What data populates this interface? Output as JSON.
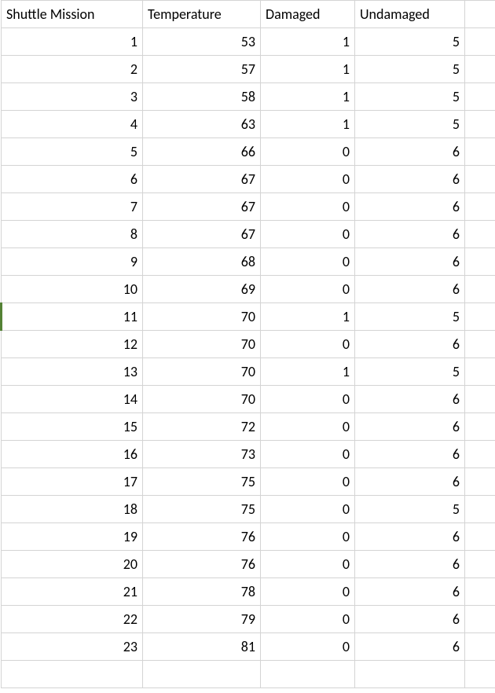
{
  "headers": {
    "mission": "Shuttle Mission",
    "temperature": "Temperature",
    "damaged": "Damaged",
    "undamaged": "Undamaged"
  },
  "rows": [
    {
      "mission": 1,
      "temperature": 53,
      "damaged": 1,
      "undamaged": 5
    },
    {
      "mission": 2,
      "temperature": 57,
      "damaged": 1,
      "undamaged": 5
    },
    {
      "mission": 3,
      "temperature": 58,
      "damaged": 1,
      "undamaged": 5
    },
    {
      "mission": 4,
      "temperature": 63,
      "damaged": 1,
      "undamaged": 5
    },
    {
      "mission": 5,
      "temperature": 66,
      "damaged": 0,
      "undamaged": 6
    },
    {
      "mission": 6,
      "temperature": 67,
      "damaged": 0,
      "undamaged": 6
    },
    {
      "mission": 7,
      "temperature": 67,
      "damaged": 0,
      "undamaged": 6
    },
    {
      "mission": 8,
      "temperature": 67,
      "damaged": 0,
      "undamaged": 6
    },
    {
      "mission": 9,
      "temperature": 68,
      "damaged": 0,
      "undamaged": 6
    },
    {
      "mission": 10,
      "temperature": 69,
      "damaged": 0,
      "undamaged": 6
    },
    {
      "mission": 11,
      "temperature": 70,
      "damaged": 1,
      "undamaged": 5
    },
    {
      "mission": 12,
      "temperature": 70,
      "damaged": 0,
      "undamaged": 6
    },
    {
      "mission": 13,
      "temperature": 70,
      "damaged": 1,
      "undamaged": 5
    },
    {
      "mission": 14,
      "temperature": 70,
      "damaged": 0,
      "undamaged": 6
    },
    {
      "mission": 15,
      "temperature": 72,
      "damaged": 0,
      "undamaged": 6
    },
    {
      "mission": 16,
      "temperature": 73,
      "damaged": 0,
      "undamaged": 6
    },
    {
      "mission": 17,
      "temperature": 75,
      "damaged": 0,
      "undamaged": 6
    },
    {
      "mission": 18,
      "temperature": 75,
      "damaged": 0,
      "undamaged": 5
    },
    {
      "mission": 19,
      "temperature": 76,
      "damaged": 0,
      "undamaged": 6
    },
    {
      "mission": 20,
      "temperature": 76,
      "damaged": 0,
      "undamaged": 6
    },
    {
      "mission": 21,
      "temperature": 78,
      "damaged": 0,
      "undamaged": 6
    },
    {
      "mission": 22,
      "temperature": 79,
      "damaged": 0,
      "undamaged": 6
    },
    {
      "mission": 23,
      "temperature": 81,
      "damaged": 0,
      "undamaged": 6
    }
  ],
  "selected_row_index": 10
}
